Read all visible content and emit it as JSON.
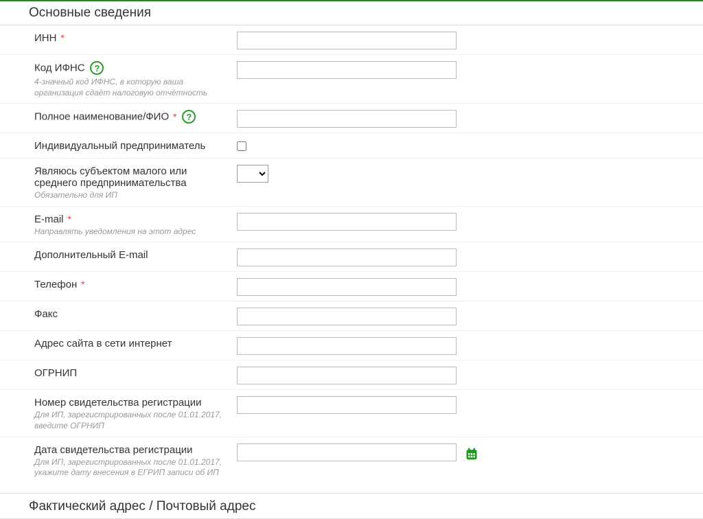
{
  "section1": {
    "title": "Основные сведения"
  },
  "section2": {
    "title": "Фактический адрес / Почтовый адрес"
  },
  "fields": {
    "inn": {
      "label": "ИНН",
      "required": "*"
    },
    "ifns": {
      "label": "Код ИФНС",
      "hint": "4-значный код ИФНС, в которую ваша организация сдаёт налоговую отчётность"
    },
    "fullname": {
      "label": "Полное наименование/ФИО",
      "required": "*"
    },
    "ip": {
      "label": "Индивидуальный предприниматель"
    },
    "sme": {
      "label": "Являюсь субъектом малого или среднего предпринимательства",
      "hint": "Обязательно для ИП"
    },
    "email": {
      "label": "E-mail",
      "required": "*",
      "hint": "Направлять уведомления на этот адрес"
    },
    "email2": {
      "label": "Дополнительный E-mail"
    },
    "phone": {
      "label": "Телефон",
      "required": "*"
    },
    "fax": {
      "label": "Факс"
    },
    "website": {
      "label": "Адрес сайта в сети интернет"
    },
    "ogrnip": {
      "label": "ОГРНИП"
    },
    "certnum": {
      "label": "Номер свидетельства регистрации",
      "hint": "Для ИП, зарегистрированных после 01.01.2017, введите ОГРНИП"
    },
    "certdate": {
      "label": "Дата свидетельства регистрации",
      "hint": "Для ИП, зарегистрированных после 01.01.2017, укажите дату внесения в ЕГРИП записи об ИП"
    }
  },
  "helpSymbol": "?"
}
